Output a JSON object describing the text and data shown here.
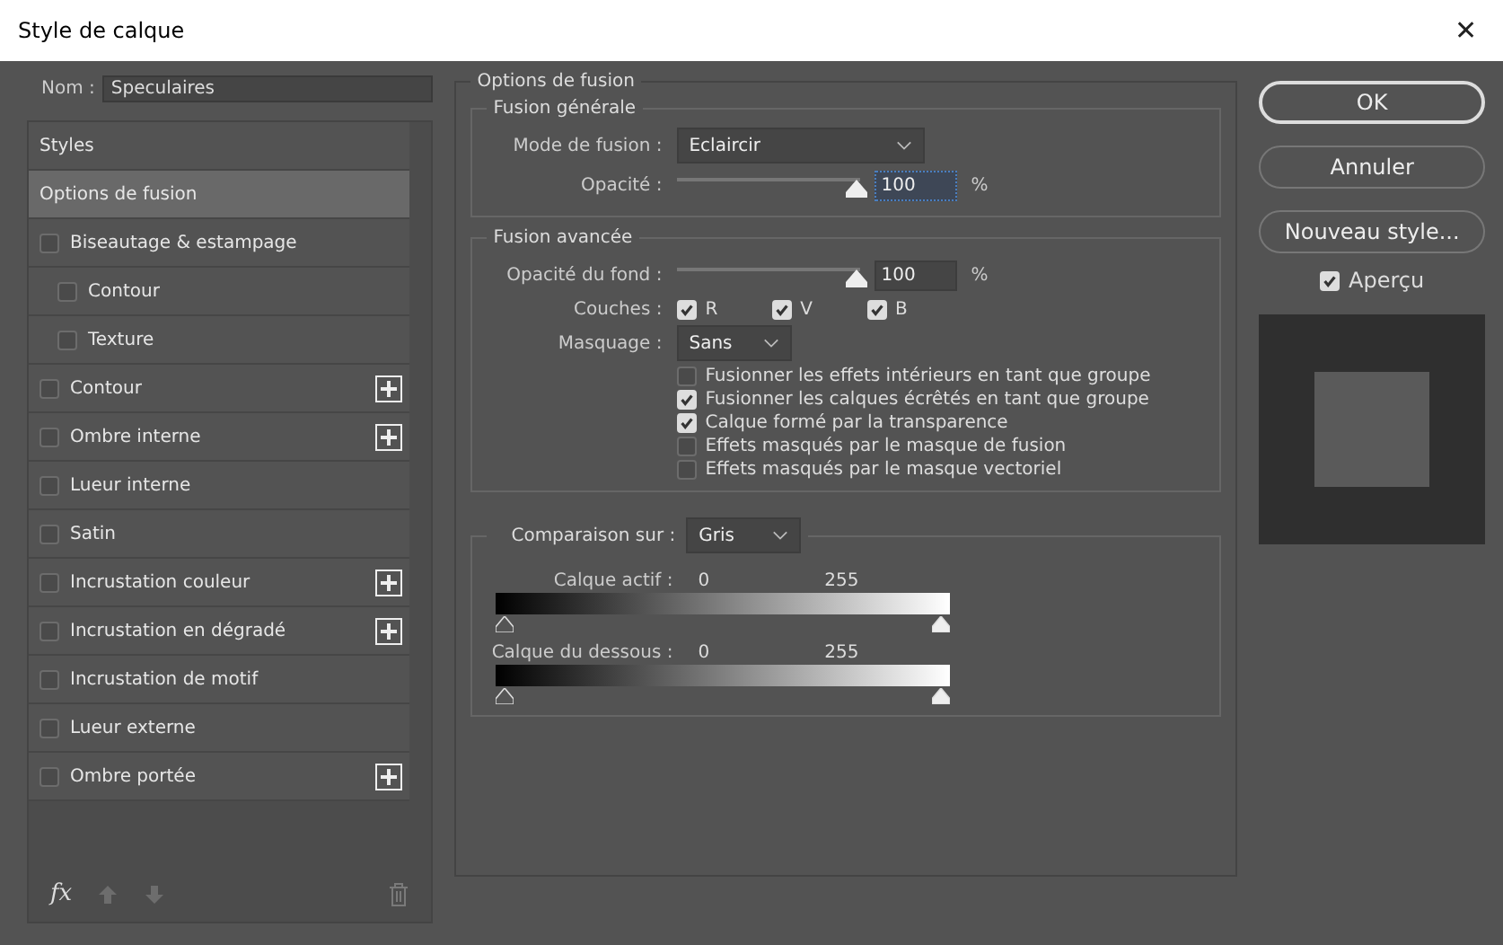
{
  "window": {
    "title": "Style de calque",
    "close": "✕"
  },
  "name_field": {
    "label": "Nom :",
    "value": "Speculaires"
  },
  "styles": [
    {
      "kind": "header",
      "label": "Styles",
      "selected": false
    },
    {
      "kind": "option",
      "label": "Options de fusion",
      "selected": true
    },
    {
      "kind": "effect",
      "label": "Biseautage & estampage",
      "checked": false,
      "selected": false,
      "add": false,
      "children": [
        {
          "kind": "effect",
          "label": "Contour",
          "checked": false,
          "selected": false,
          "add": false
        },
        {
          "kind": "effect",
          "label": "Texture",
          "checked": false,
          "selected": false,
          "add": false
        }
      ]
    },
    {
      "kind": "effect",
      "label": "Contour",
      "checked": false,
      "selected": false,
      "add": true
    },
    {
      "kind": "effect",
      "label": "Ombre interne",
      "checked": false,
      "selected": false,
      "add": true
    },
    {
      "kind": "effect",
      "label": "Lueur interne",
      "checked": false,
      "selected": false,
      "add": false
    },
    {
      "kind": "effect",
      "label": "Satin",
      "checked": false,
      "selected": false,
      "add": false
    },
    {
      "kind": "effect",
      "label": "Incrustation couleur",
      "checked": false,
      "selected": false,
      "add": true
    },
    {
      "kind": "effect",
      "label": "Incrustation en dégradé",
      "checked": false,
      "selected": false,
      "add": true
    },
    {
      "kind": "effect",
      "label": "Incrustation de motif",
      "checked": false,
      "selected": false,
      "add": false
    },
    {
      "kind": "effect",
      "label": "Lueur externe",
      "checked": false,
      "selected": false,
      "add": false
    },
    {
      "kind": "effect",
      "label": "Ombre portée",
      "checked": false,
      "selected": false,
      "add": true
    }
  ],
  "styles_toolbar": {
    "fx": "fx"
  },
  "blending": {
    "title": "Options de fusion",
    "general": {
      "title": "Fusion générale",
      "mode_label": "Mode de fusion :",
      "mode": "Eclaircir",
      "opacity_label": "Opacité :",
      "opacity": {
        "level": 1,
        "value": "100",
        "focused": true
      },
      "unit": "%"
    },
    "advanced": {
      "title": "Fusion avancée",
      "fill_label": "Opacité du fond :",
      "fill": {
        "level": 1,
        "value": "100",
        "focused": false
      },
      "unit": "%",
      "channels_label": "Couches :",
      "channels": [
        {
          "label": "R",
          "checked": true
        },
        {
          "label": "V",
          "checked": true
        },
        {
          "label": "B",
          "checked": true
        }
      ],
      "knockout_label": "Masquage :",
      "knockout": "Sans",
      "options": [
        {
          "label": "Fusionner les effets intérieurs en tant que groupe",
          "checked": false
        },
        {
          "label": "Fusionner les calques écrêtés en tant que groupe",
          "checked": true
        },
        {
          "label": "Calque formé par la transparence",
          "checked": true
        },
        {
          "label": "Effets masqués par le masque de fusion",
          "checked": false
        },
        {
          "label": "Effets masqués par le masque vectoriel",
          "checked": false
        }
      ]
    },
    "blend_if": {
      "label": "Comparaison sur :",
      "value": "Gris",
      "ranges": [
        {
          "label": "Calque actif :",
          "low": "0",
          "high": "255",
          "thumbs": [
            {
              "level": 0
            },
            {
              "level": 1
            }
          ]
        },
        {
          "label": "Calque du dessous :",
          "low": "0",
          "high": "255",
          "thumbs": [
            {
              "level": 0
            },
            {
              "level": 1
            }
          ]
        }
      ]
    }
  },
  "buttons": [
    {
      "label": "OK",
      "default": true
    },
    {
      "label": "Annuler",
      "default": false
    },
    {
      "label": "Nouveau style...",
      "default": false
    }
  ],
  "preview": {
    "label": "Aperçu",
    "checked": true
  }
}
